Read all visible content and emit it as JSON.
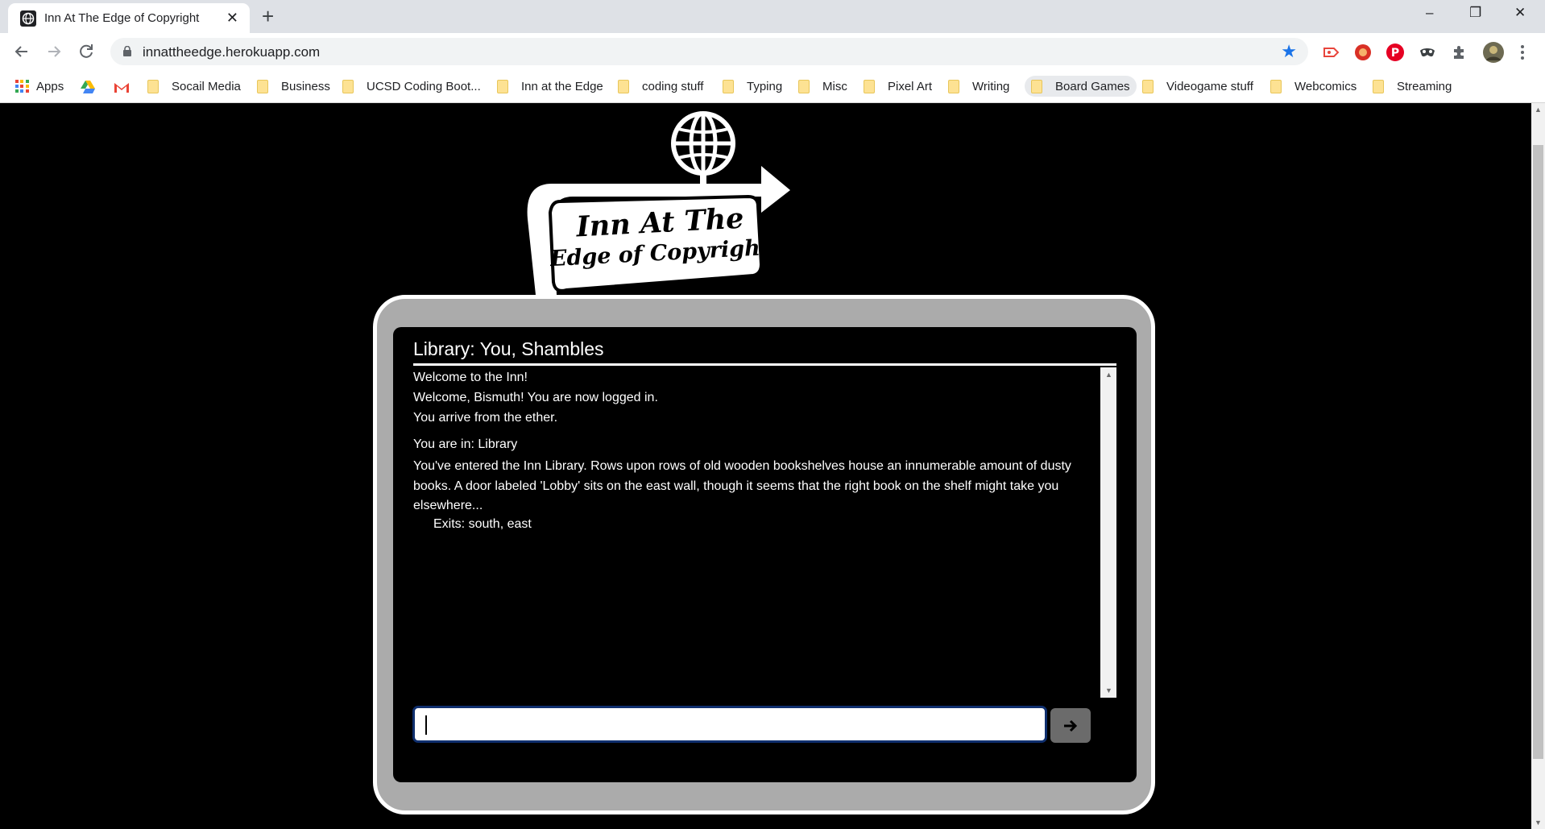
{
  "browser": {
    "tab_title": "Inn At The Edge of Copyright",
    "close_glyph": "✕",
    "new_tab_glyph": "+",
    "window_controls": {
      "minimize": "–",
      "restore": "❐",
      "close": "✕"
    },
    "url": "innattheedge.herokuapp.com",
    "bookmarks": [
      {
        "label": "Apps",
        "kind": "apps"
      },
      {
        "label": "Socail Media",
        "kind": "folder"
      },
      {
        "label": "Business",
        "kind": "folder"
      },
      {
        "label": "UCSD Coding Boot...",
        "kind": "folder"
      },
      {
        "label": "Inn at the Edge",
        "kind": "folder"
      },
      {
        "label": "coding stuff",
        "kind": "folder"
      },
      {
        "label": "Typing",
        "kind": "folder"
      },
      {
        "label": "Misc",
        "kind": "folder"
      },
      {
        "label": "Pixel Art",
        "kind": "folder"
      },
      {
        "label": "Writing",
        "kind": "folder"
      },
      {
        "label": "Board Games",
        "kind": "folder",
        "active": true
      },
      {
        "label": "Videogame stuff",
        "kind": "folder"
      },
      {
        "label": "Webcomics",
        "kind": "folder"
      },
      {
        "label": "Streaming",
        "kind": "folder"
      }
    ]
  },
  "logo": {
    "line1": "Inn At The",
    "line2": "Edge of Copyright"
  },
  "game": {
    "room_header": "Library: You, Shambles",
    "log": {
      "welcome": "Welcome to the Inn!",
      "login": "Welcome, Bismuth! You are now logged in.",
      "arrive": "You arrive from the ether.",
      "location": "You are in: Library",
      "description": "You've entered the Inn Library. Rows upon rows of old wooden bookshelves house an innumerable amount of dusty books. A door labeled 'Lobby' sits on the east wall, though it seems that the right book on the shelf might take you elsewhere...",
      "exits": "Exits: south, east"
    },
    "input_value": ""
  },
  "colors": {
    "page_background": "#000000",
    "frame": "#ababab",
    "input_border": "#0f2f6e",
    "send_button": "#6b6b6b",
    "bookmark_star": "#1a73e8"
  }
}
